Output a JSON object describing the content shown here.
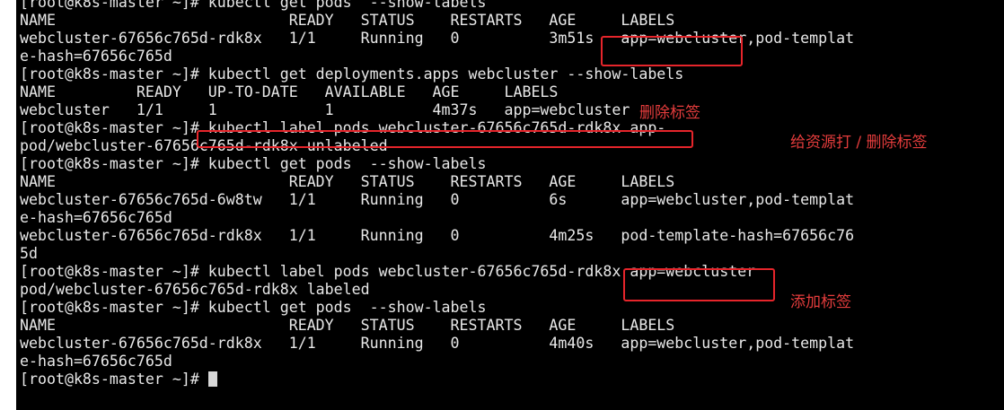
{
  "terminal": {
    "lines": [
      "[root@k8s-master ~]# kubectl get pods  --show-labels",
      "NAME                          READY   STATUS    RESTARTS   AGE     LABELS",
      "webcluster-67656c765d-rdk8x   1/1     Running   0          3m51s   app=webcluster,pod-templat",
      "e-hash=67656c765d",
      "[root@k8s-master ~]# kubectl get deployments.apps webcluster --show-labels",
      "NAME         READY   UP-TO-DATE   AVAILABLE   AGE     LABELS",
      "webcluster   1/1     1            1           4m37s   app=webcluster",
      "[root@k8s-master ~]# kubectl label pods webcluster-67656c765d-rdk8x app-",
      "pod/webcluster-67656c765d-rdk8x unlabeled",
      "[root@k8s-master ~]# kubectl get pods  --show-labels",
      "NAME                          READY   STATUS    RESTARTS   AGE     LABELS",
      "webcluster-67656c765d-6w8tw   1/1     Running   0          6s      app=webcluster,pod-templat",
      "e-hash=67656c765d",
      "webcluster-67656c765d-rdk8x   1/1     Running   0          4m25s   pod-template-hash=67656c76",
      "5d",
      "[root@k8s-master ~]# kubectl label pods webcluster-67656c765d-rdk8x app=webcluster",
      "pod/webcluster-67656c765d-rdk8x labeled",
      "[root@k8s-master ~]# kubectl get pods  --show-labels",
      "NAME                          READY   STATUS    RESTARTS   AGE     LABELS",
      "webcluster-67656c765d-rdk8x   1/1     Running   0          4m40s   app=webcluster,pod-templat",
      "e-hash=67656c765d",
      "[root@k8s-master ~]# "
    ]
  },
  "annotations": {
    "delete_label": "删除标签",
    "label_resource": "给资源打 / 删除标签",
    "add_label": "添加标签"
  },
  "colors": {
    "terminal_bg": "#000000",
    "terminal_text": "#e8e8e8",
    "annotation": "#e6252b"
  }
}
